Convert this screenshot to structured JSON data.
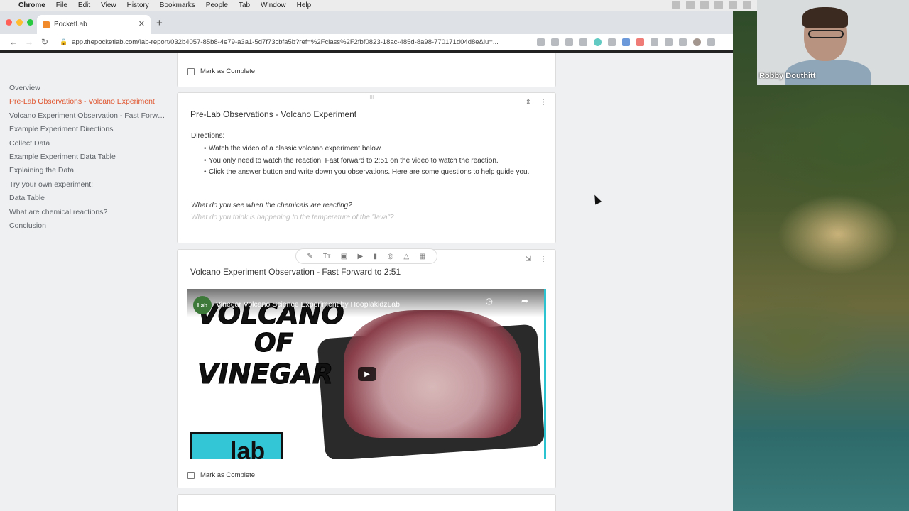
{
  "menubar": {
    "app": "Chrome",
    "items": [
      "File",
      "Edit",
      "View",
      "History",
      "Bookmarks",
      "People",
      "Tab",
      "Window",
      "Help"
    ]
  },
  "browser": {
    "tab_title": "Pocketl.ab",
    "url": "app.thepocketlab.com/lab-report/032b4057-85b8-4e79-a3a1-5d7f73cbfa5b?ref=%2Fclass%2F2fbf0823-18ac-485d-8a98-770171d04d8e&lu=..."
  },
  "sidebar": {
    "items": [
      {
        "label": "Overview",
        "active": false
      },
      {
        "label": "Pre-Lab Observations - Volcano Experiment",
        "active": true
      },
      {
        "label": "Volcano Experiment Observation - Fast Forwa...",
        "active": false
      },
      {
        "label": "Example Experiment Directions",
        "active": false
      },
      {
        "label": "Collect Data",
        "active": false
      },
      {
        "label": "Example Experiment Data Table",
        "active": false
      },
      {
        "label": "Explaining the Data",
        "active": false
      },
      {
        "label": "Try your own experiment!",
        "active": false
      },
      {
        "label": "Data Table",
        "active": false
      },
      {
        "label": "What are chemical reactions?",
        "active": false
      },
      {
        "label": "Conclusion",
        "active": false
      }
    ]
  },
  "cards": {
    "top": {
      "mark_complete": "Mark as Complete"
    },
    "prelab": {
      "title": "Pre-Lab Observations - Volcano Experiment",
      "directions_label": "Directions:",
      "bullets": [
        "Watch the video of a classic volcano experiment below.",
        "You only need to watch the reaction. Fast forward to 2:51 on the video to watch the reaction.",
        "Click the answer button and write down you observations. Here are some questions to help guide you."
      ],
      "question1": "What do you see when the chemicals are reacting?",
      "question2": "What do you think is happening to the temperature of the \"lava\"?"
    },
    "observation": {
      "title": "Volcano Experiment Observation - Fast Forward to 2:51",
      "video_title": "Vinegar Volcano Science Experiment by HooplakidzLab",
      "video_overlay_line1": "VOLCANO",
      "video_overlay_line2": "OF",
      "video_overlay_line3": "VINEGAR",
      "video_overlay_lab": "lab",
      "mark_complete": "Mark as Complete"
    }
  },
  "camera": {
    "name": "Robby Douthitt"
  },
  "colors": {
    "active_nav": "#e0542d",
    "video_border": "#2ac3cf"
  }
}
